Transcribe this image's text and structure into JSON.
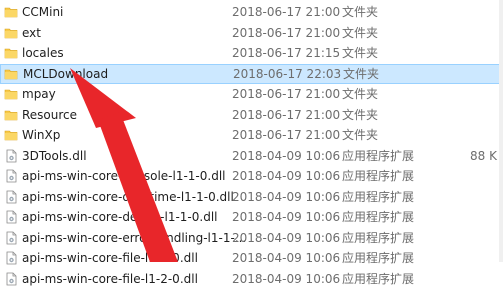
{
  "files": [
    {
      "name": "CCMini",
      "date": "2018-06-17 21:00",
      "type": "文件夹",
      "size": "",
      "icon": "folder-icon"
    },
    {
      "name": "ext",
      "date": "2018-06-17 21:00",
      "type": "文件夹",
      "size": "",
      "icon": "folder-icon"
    },
    {
      "name": "locales",
      "date": "2018-06-17 21:15",
      "type": "文件夹",
      "size": "",
      "icon": "folder-icon"
    },
    {
      "name": "MCLDownload",
      "date": "2018-06-17 22:03",
      "type": "文件夹",
      "size": "",
      "icon": "folder-icon",
      "selected": true
    },
    {
      "name": "mpay",
      "date": "2018-06-17 21:00",
      "type": "文件夹",
      "size": "",
      "icon": "folder-icon"
    },
    {
      "name": "Resource",
      "date": "2018-06-17 21:00",
      "type": "文件夹",
      "size": "",
      "icon": "folder-icon"
    },
    {
      "name": "WinXp",
      "date": "2018-06-17 21:00",
      "type": "文件夹",
      "size": "",
      "icon": "folder-icon"
    },
    {
      "name": "3DTools.dll",
      "date": "2018-04-09 10:06",
      "type": "应用程序扩展",
      "size": "88 K",
      "icon": "dll-file-icon"
    },
    {
      "name": "api-ms-win-core-console-l1-1-0.dll",
      "date": "2018-04-09 10:06",
      "type": "应用程序扩展",
      "size": "",
      "icon": "dll-file-icon"
    },
    {
      "name": "api-ms-win-core-datetime-l1-1-0.dll",
      "date": "2018-04-09 10:06",
      "type": "应用程序扩展",
      "size": "",
      "icon": "dll-file-icon"
    },
    {
      "name": "api-ms-win-core-debug-l1-1-0.dll",
      "date": "2018-04-09 10:06",
      "type": "应用程序扩展",
      "size": "",
      "icon": "dll-file-icon"
    },
    {
      "name": "api-ms-win-core-errorhandling-l1-1-...",
      "date": "2018-04-09 10:06",
      "type": "应用程序扩展",
      "size": "",
      "icon": "dll-file-icon"
    },
    {
      "name": "api-ms-win-core-file-l1-1-0.dll",
      "date": "2018-04-09 10:06",
      "type": "应用程序扩展",
      "size": "",
      "icon": "dll-file-icon"
    },
    {
      "name": "api-ms-win-core-file-l1-2-0.dll",
      "date": "2018-04-09 10:06",
      "type": "应用程序扩展",
      "size": "",
      "icon": "dll-file-icon"
    }
  ],
  "annotation": {
    "arrow_color": "#e8262a"
  },
  "colors": {
    "selection_bg": "#cce8ff",
    "selection_border": "#99d1ff",
    "folder": "#f7c948"
  }
}
